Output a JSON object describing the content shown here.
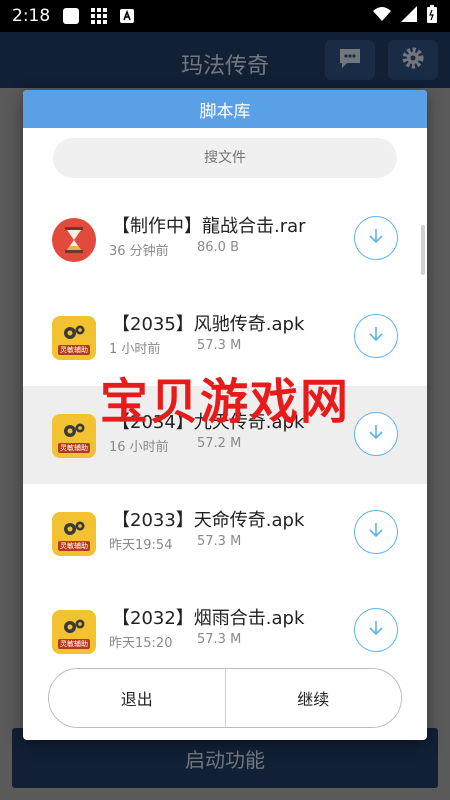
{
  "status_bar": {
    "time": "2:18"
  },
  "app": {
    "title": "玛法传奇",
    "start_button": "启动功能"
  },
  "dialog": {
    "title": "脚本库",
    "search_placeholder": "搜文件",
    "items": [
      {
        "name": "【制作中】龍战合击.rar",
        "time": "36 分钟前",
        "size": "86.0 B",
        "icon": "hourglass-icon"
      },
      {
        "name": "【2035】风驰传奇.apk",
        "time": "1 小时前",
        "size": "57.3 M",
        "icon": "app-gear-icon"
      },
      {
        "name": "【2034】九天传奇.apk",
        "time": "16 小时前",
        "size": "57.2 M",
        "icon": "app-gear-icon"
      },
      {
        "name": "【2033】天命传奇.apk",
        "time": "昨天19:54",
        "size": "57.3 M",
        "icon": "app-gear-icon"
      },
      {
        "name": "【2032】烟雨合击.apk",
        "time": "昨天15:20",
        "size": "57.3 M",
        "icon": "app-gear-icon"
      }
    ],
    "app_icon_label": "灵敏辅助",
    "exit_label": "退出",
    "continue_label": "继续"
  },
  "watermark": "宝贝游戏网",
  "colors": {
    "dialog_title_bg": "#5aa0e6",
    "download_accent": "#5ab4e6",
    "app_icon_bg": "#f2c231",
    "watermark": "#e81a1a"
  }
}
